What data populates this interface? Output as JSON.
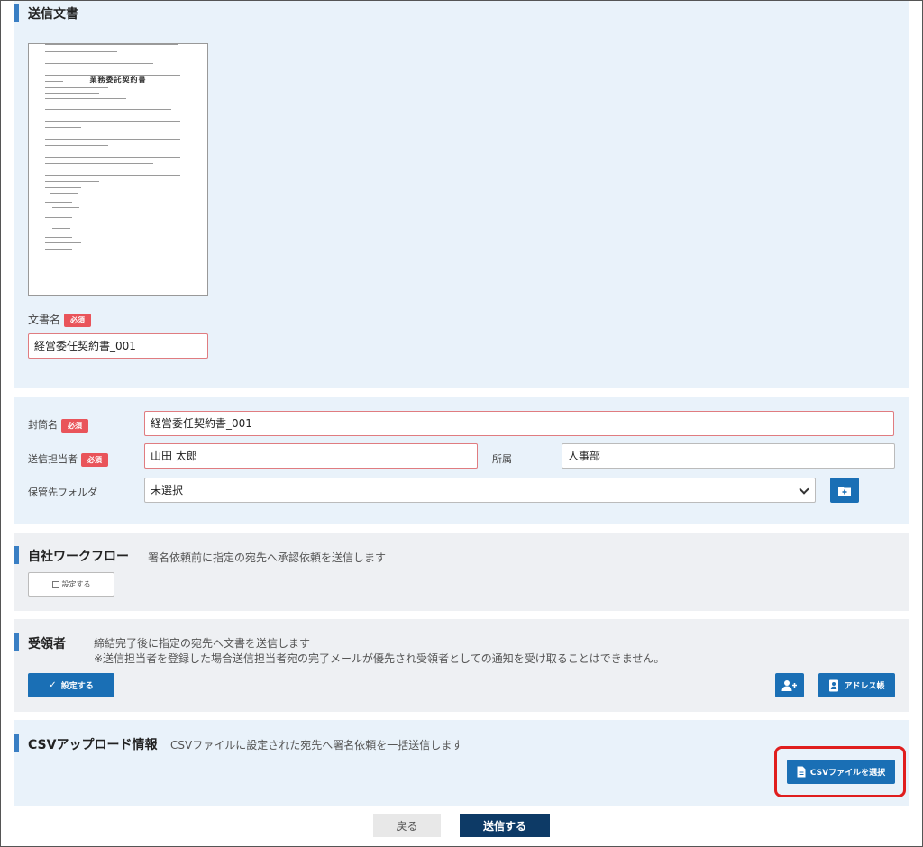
{
  "sections": {
    "document": {
      "title": "送信文書",
      "preview_title": "業務委託契約書",
      "name_label": "文書名",
      "required_badge": "必須",
      "name_value": "経営委任契約書_001"
    },
    "envelope": {
      "name_label": "封筒名",
      "required_badge": "必須",
      "name_value": "経営委任契約書_001",
      "sender_label": "送信担当者",
      "sender_value": "山田 太郎",
      "dept_label": "所属",
      "dept_value": "人事部",
      "folder_label": "保管先フォルダ",
      "folder_value": "未選択"
    },
    "workflow": {
      "title": "自社ワークフロー",
      "desc": "署名依頼前に指定の宛先へ承認依頼を送信します",
      "button_label": "設定する"
    },
    "recipient": {
      "title": "受領者",
      "desc_1": "締結完了後に指定の宛先へ文書を送信します",
      "desc_2": "※送信担当者を登録した場合送信担当者宛の完了メールが優先され受領者としての通知を受け取ることはできません。",
      "button_label": "設定する",
      "address_book_label": "アドレス帳"
    },
    "csv": {
      "title": "CSVアップロード情報",
      "desc": "CSVファイルに設定された宛先へ署名依頼を一括送信します",
      "button_label": "CSVファイルを選択"
    }
  },
  "footer": {
    "back_label": "戻る",
    "send_label": "送信する"
  },
  "colors": {
    "panel_bg": "#e9f2fa",
    "panel_gray": "#eef0f3",
    "primary": "#1a6fb5",
    "required": "#e9545a",
    "highlight": "#e01e1e",
    "footer_send": "#0d3a66"
  }
}
